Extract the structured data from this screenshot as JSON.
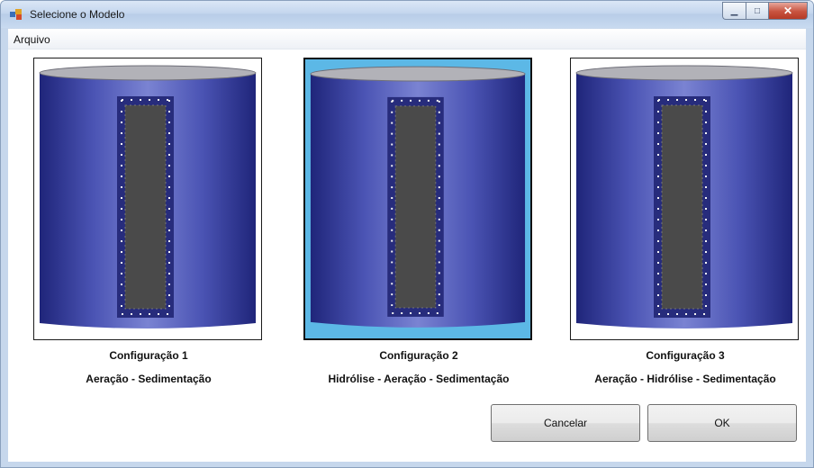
{
  "window": {
    "title": "Selecione o Modelo"
  },
  "menu": {
    "items": [
      "Arquivo"
    ]
  },
  "configurations": [
    {
      "title": "Configuração 1",
      "description": "Aeração - Sedimentação",
      "selected": false
    },
    {
      "title": "Configuração 2",
      "description": "Hidrólise - Aeração - Sedimentação",
      "selected": true
    },
    {
      "title": "Configuração 3",
      "description": "Aeração - Hidrólise - Sedimentação",
      "selected": false
    }
  ],
  "buttons": {
    "cancel": "Cancelar",
    "ok": "OK"
  },
  "colors": {
    "tank": "#3f48a4",
    "selection_background": "#5cb8e6",
    "window_frame": "#c6d7ec"
  }
}
